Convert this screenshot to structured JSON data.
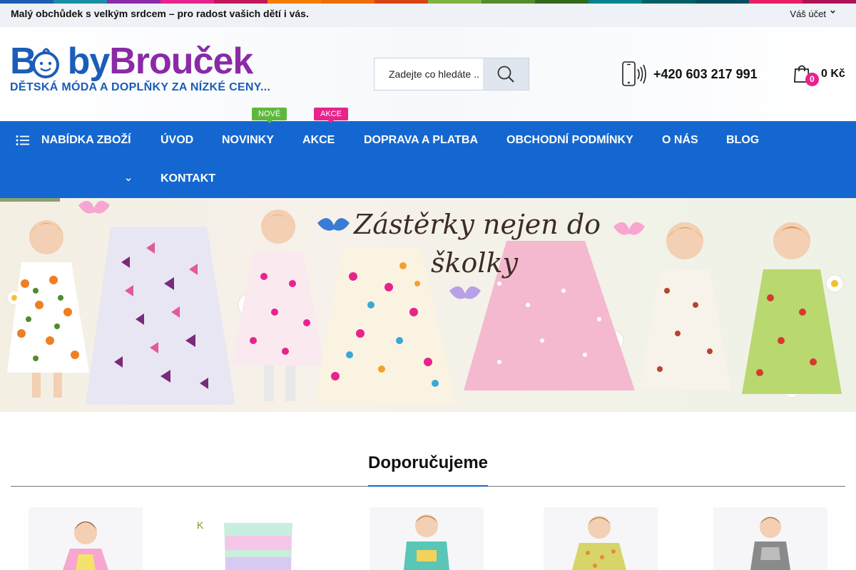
{
  "topbar": {
    "slogan": "Malý obchůdek s velkým srdcem – pro radost vašich dětí i vás.",
    "account_label": "Váš účet",
    "account_icon": "chevron-down-icon"
  },
  "brand": {
    "logo_part1": "B",
    "logo_part2": "by",
    "logo_part3": "Brouček",
    "tagline": "DĚTSKÁ MÓDA A DOPLŇKY ZA NÍZKÉ CENY...",
    "primary_color": "#1467d0",
    "accent_color": "#e7238c"
  },
  "search": {
    "placeholder": "Zadejte co hledáte ..",
    "button_icon": "search-icon"
  },
  "contact": {
    "phone": "+420 603 217 991",
    "icon": "phone-icon"
  },
  "cart": {
    "count": "0",
    "total": "0 Kč",
    "icon": "shopping-bag-icon"
  },
  "nav": {
    "catalog_label": "NABÍDKA ZBOŽÍ",
    "items": [
      {
        "label": "ÚVOD"
      },
      {
        "label": "NOVINKY",
        "tag": "NOVÉ"
      },
      {
        "label": "AKCE",
        "tag": "AKCE"
      },
      {
        "label": "DOPRAVA A PLATBA"
      },
      {
        "label": "OBCHODNÍ PODMÍNKY"
      },
      {
        "label": "O NÁS"
      },
      {
        "label": "BLOG"
      },
      {
        "label": "KONTAKT"
      }
    ]
  },
  "banner": {
    "title_line1": "Zástěrky nejen do",
    "title_line2": "školky"
  },
  "section": {
    "title": "Doporučujeme"
  }
}
